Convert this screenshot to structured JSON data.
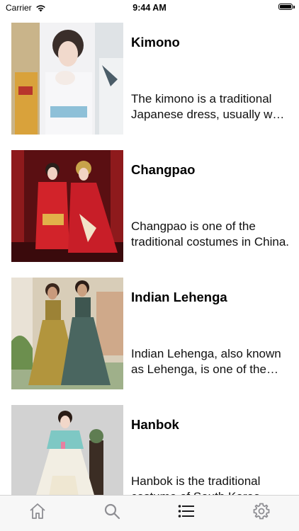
{
  "status_bar": {
    "carrier": "Carrier",
    "time": "9:44 AM",
    "battery_level": 1.0
  },
  "items": [
    {
      "title": "Kimono",
      "description": "The kimono is a traditional Japanese dress, usually worn on special occasions."
    },
    {
      "title": "Changpao",
      "description": "Changpao is one of the traditional costumes in China."
    },
    {
      "title": "Indian Lehenga",
      "description": "Indian Lehenga, also known as Lehenga, is one of the traditional outfits of India."
    },
    {
      "title": "Hanbok",
      "description": "Hanbok is the traditional costume of South Korea."
    }
  ],
  "tab_bar": {
    "tabs": [
      {
        "icon": "home-icon",
        "selected": false
      },
      {
        "icon": "search-icon",
        "selected": false
      },
      {
        "icon": "list-icon",
        "selected": true
      },
      {
        "icon": "gear-icon",
        "selected": false
      }
    ],
    "colors": {
      "selected": "#1c1c1e",
      "unselected": "#8e8e93"
    }
  }
}
